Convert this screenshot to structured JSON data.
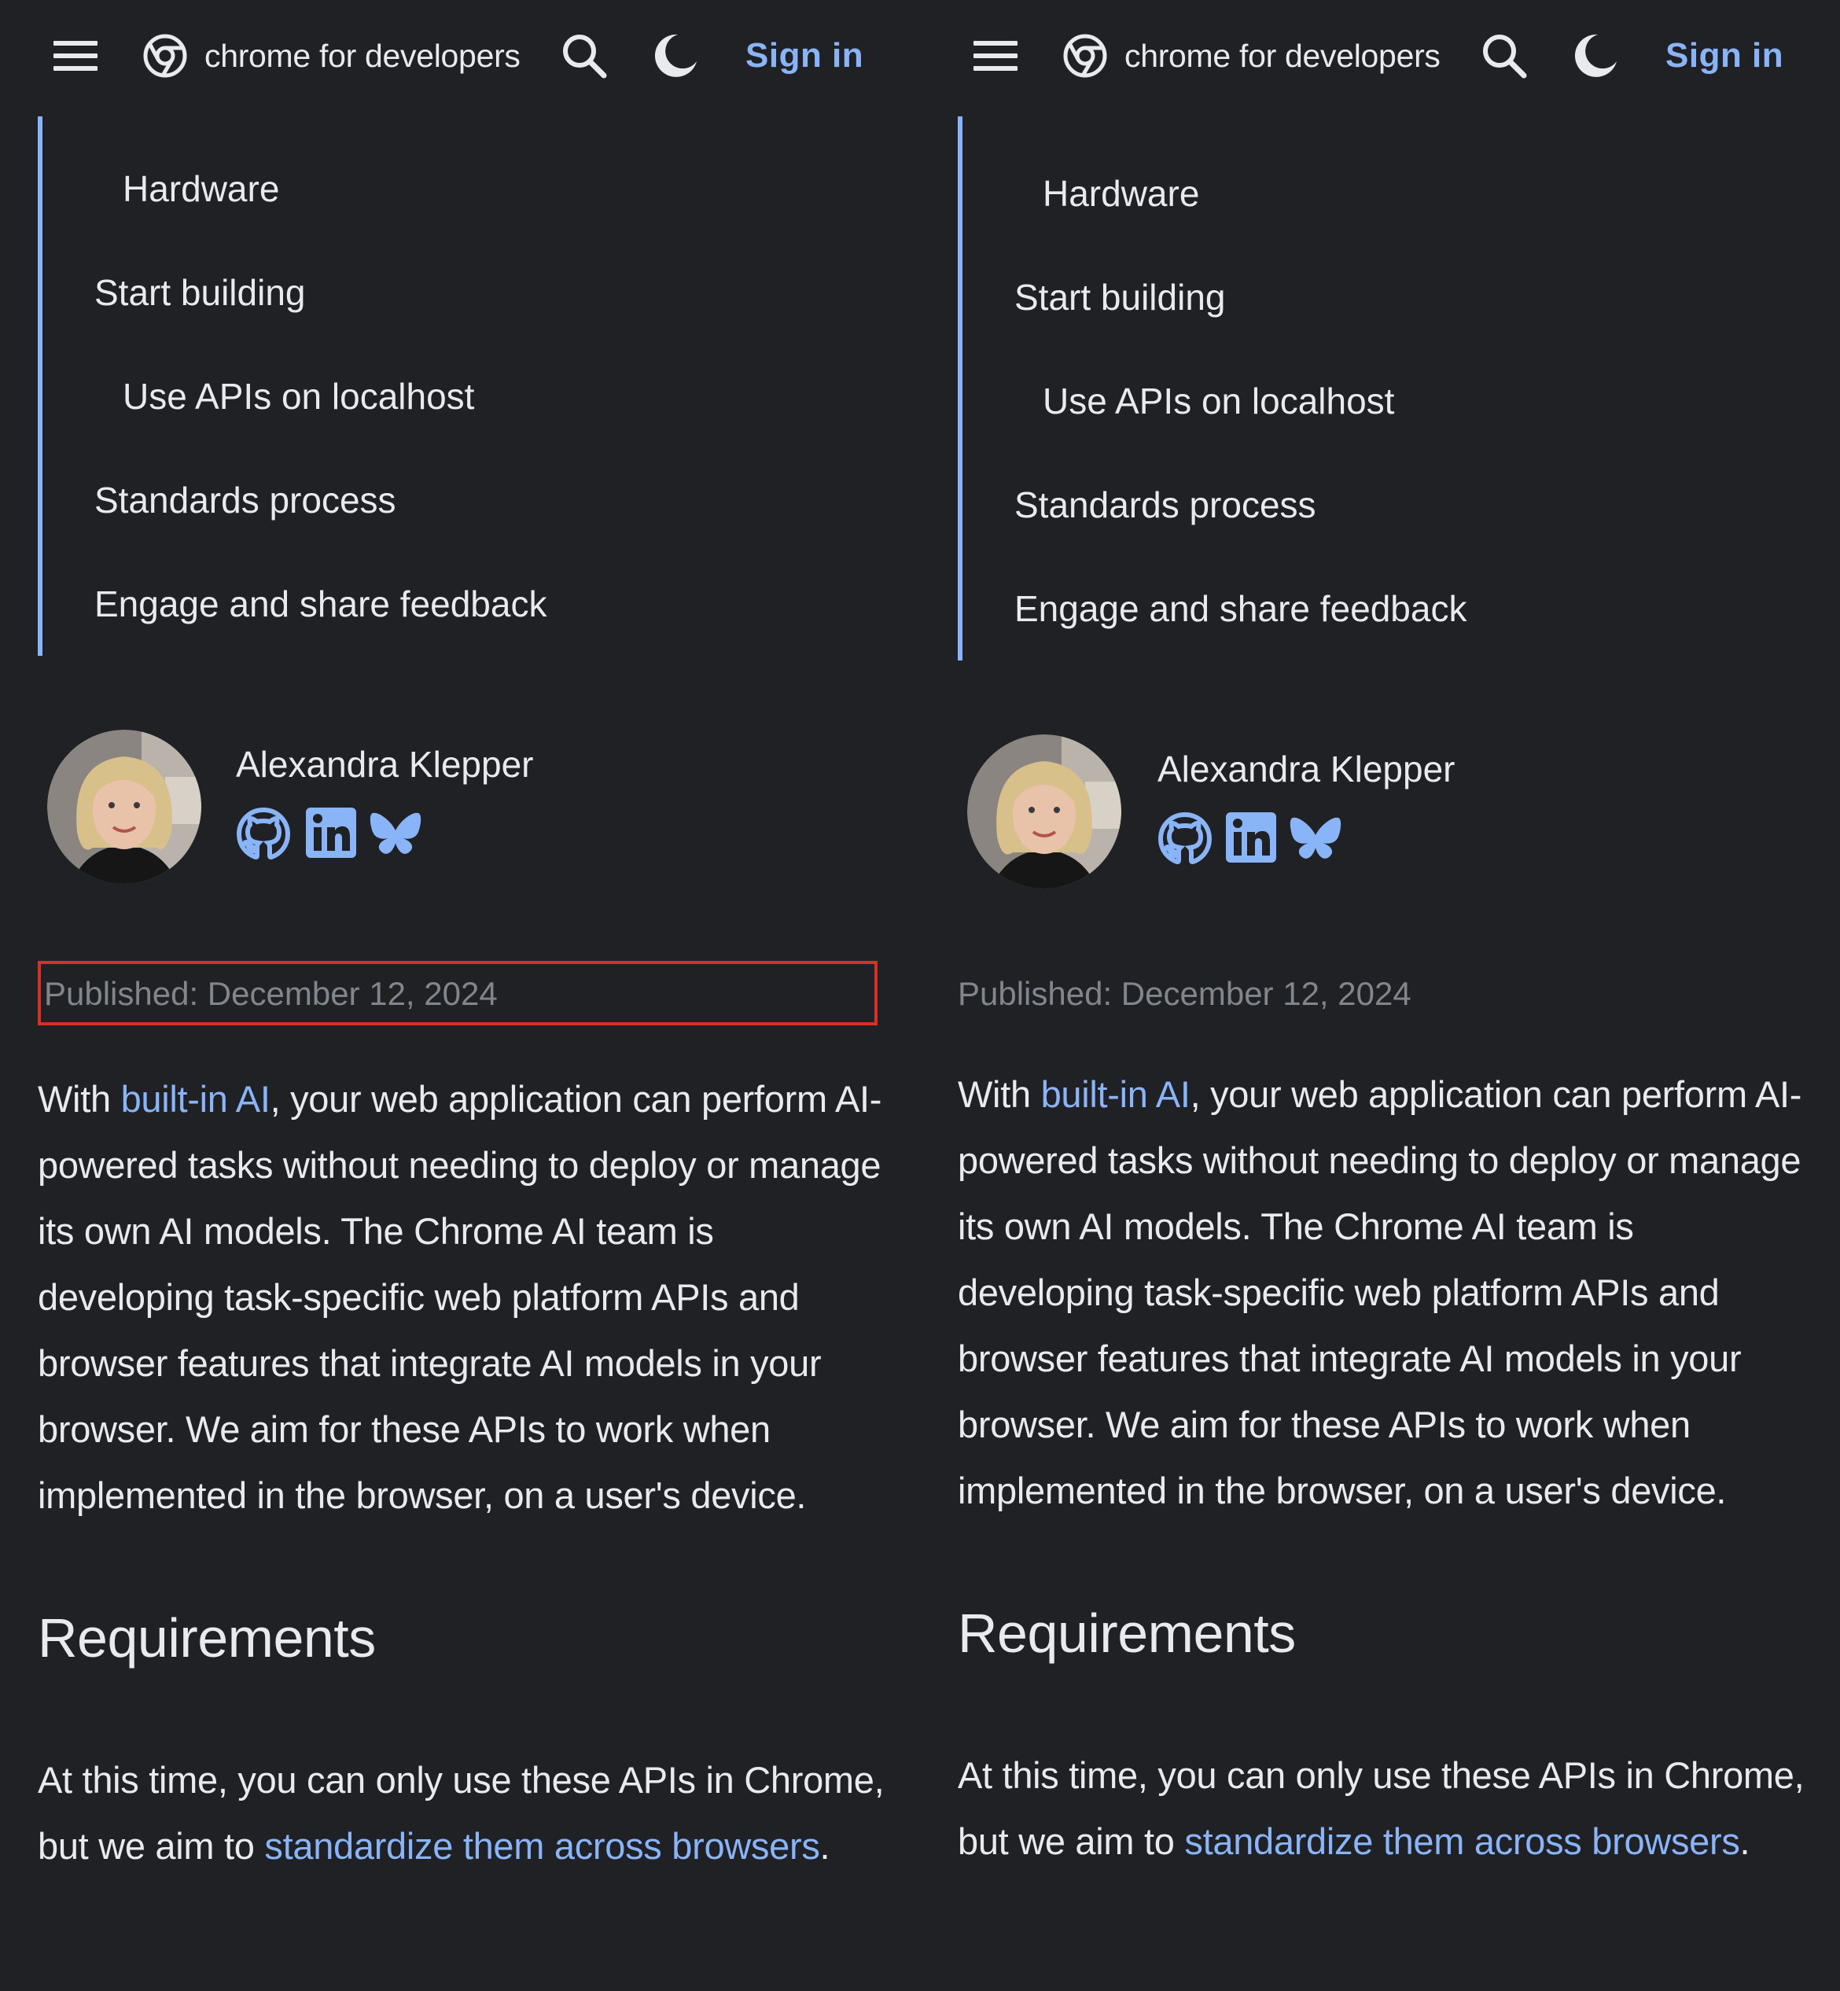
{
  "header": {
    "brand": "chrome for developers",
    "sign_in": "Sign in",
    "icons": [
      "menu-icon",
      "chrome-logo-icon",
      "search-icon",
      "dark-theme-icon"
    ]
  },
  "toc": {
    "items": [
      {
        "label": "Hardware",
        "indent": true
      },
      {
        "label": "Start building",
        "indent": false
      },
      {
        "label": "Use APIs on localhost",
        "indent": true
      },
      {
        "label": "Standards process",
        "indent": false
      },
      {
        "label": "Engage and share feedback",
        "indent": false
      }
    ]
  },
  "author": {
    "name": "Alexandra Klepper",
    "social_icons": [
      "github-icon",
      "linkedin-icon",
      "bluesky-icon"
    ]
  },
  "meta": {
    "published": "Published: December 12, 2024"
  },
  "intro": {
    "before_link": "With ",
    "link": "built-in AI",
    "after_link": ", your web application can perform AI-powered tasks without needing to deploy or manage its own AI models. The Chrome AI team is developing task-specific web platform APIs and browser features that integrate AI models in your browser. We aim for these APIs to work when implemented in the browser, on a user's device."
  },
  "requirements": {
    "heading": "Requirements",
    "before_link": "At this time, you can only use these APIs in Chrome, but we aim to ",
    "link": "standardize them across browsers",
    "after_link": "."
  },
  "colors": {
    "background": "#202124",
    "text": "#e8eaed",
    "link": "#8ab4f8",
    "muted": "#80868b",
    "highlight": "#d93025"
  }
}
